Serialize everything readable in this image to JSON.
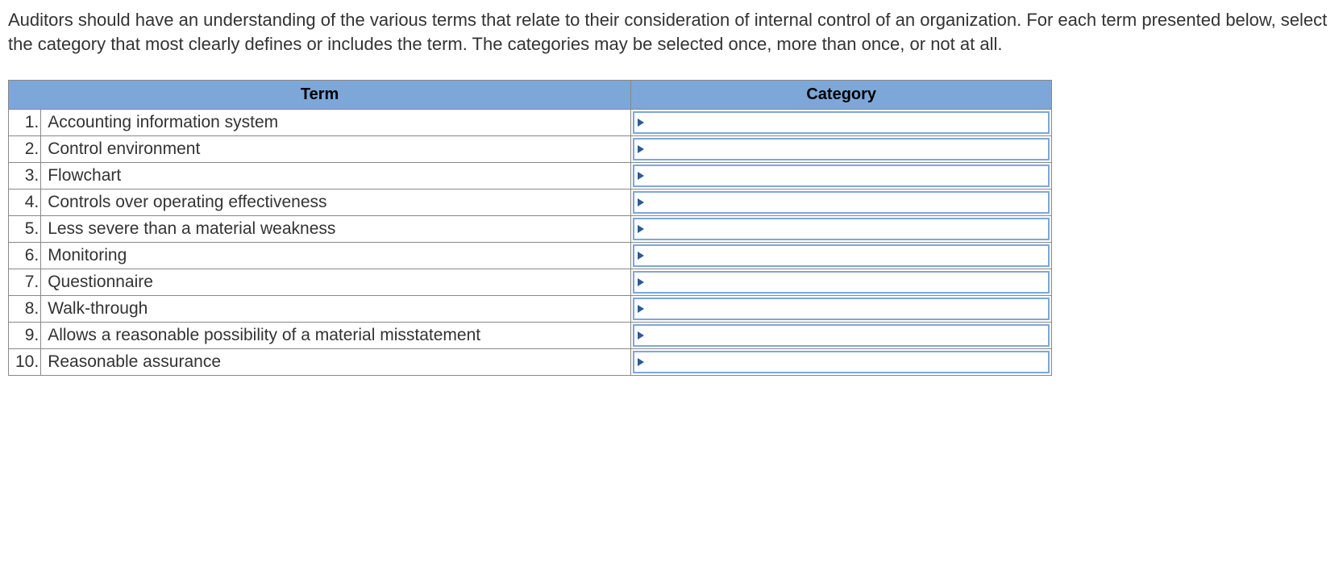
{
  "instructions": "Auditors should have an understanding of the various terms that relate to their consideration of internal control of an organization. For each term presented below, select the category that most clearly defines or includes the term. The categories may be selected once, more than once, or not at all.",
  "headers": {
    "term": "Term",
    "category": "Category"
  },
  "rows": [
    {
      "num": "1.",
      "term": "Accounting information system",
      "category": ""
    },
    {
      "num": "2.",
      "term": "Control environment",
      "category": ""
    },
    {
      "num": "3.",
      "term": "Flowchart",
      "category": ""
    },
    {
      "num": "4.",
      "term": "Controls over operating effectiveness",
      "category": ""
    },
    {
      "num": "5.",
      "term": "Less severe than a material weakness",
      "category": ""
    },
    {
      "num": "6.",
      "term": "Monitoring",
      "category": ""
    },
    {
      "num": "7.",
      "term": "Questionnaire",
      "category": ""
    },
    {
      "num": "8.",
      "term": "Walk-through",
      "category": ""
    },
    {
      "num": "9.",
      "term": "Allows a reasonable possibility of a material misstatement",
      "category": ""
    },
    {
      "num": "10.",
      "term": "Reasonable assurance",
      "category": ""
    }
  ]
}
